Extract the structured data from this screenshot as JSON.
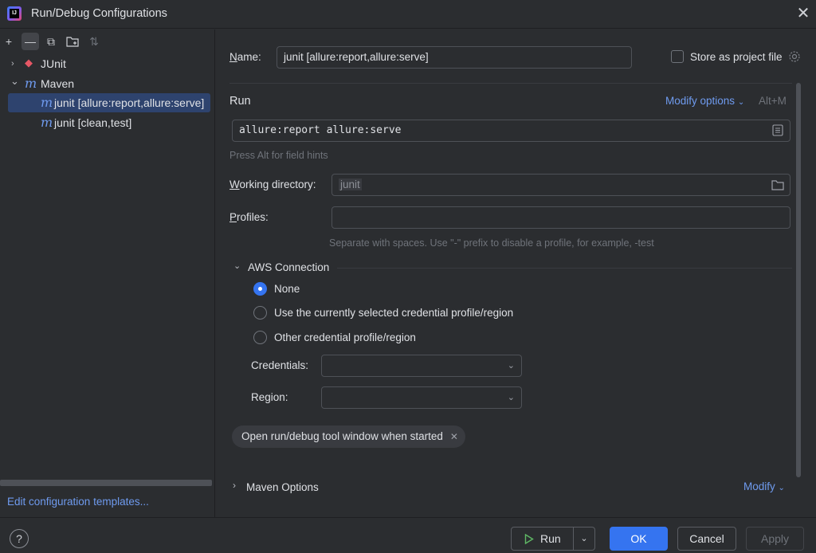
{
  "window": {
    "title": "Run/Debug Configurations",
    "close_glyph": "✕"
  },
  "toolbar": {
    "add": "+",
    "remove": "—",
    "copy": "⧉",
    "folder": "▭",
    "sort": "⇅"
  },
  "tree": {
    "junit": {
      "chev": "›",
      "icon": "◆",
      "label": "JUnit"
    },
    "maven": {
      "chev": "⌄",
      "icon": "m",
      "label": "Maven"
    },
    "item_allure": {
      "icon": "m",
      "label": "junit [allure:report,allure:serve]"
    },
    "item_clean": {
      "icon": "m",
      "label": "junit [clean,test]"
    }
  },
  "edit_templates": "Edit configuration templates...",
  "name": {
    "label_u": "N",
    "label_rest": "ame:",
    "value": "junit [allure:report,allure:serve]"
  },
  "store_as_project_file": "Store as project file",
  "run": {
    "heading": "Run",
    "modify_options": "Modify options",
    "shortcut": "Alt+M",
    "command": "allure:report allure:serve",
    "hint": "Press Alt for field hints"
  },
  "working_dir": {
    "label_u": "W",
    "label_rest": "orking directory:",
    "value": "junit"
  },
  "profiles": {
    "label_u": "P",
    "label_rest": "rofiles:",
    "value": "",
    "hint": "Separate with spaces. Use \"-\" prefix to disable a profile, for example, -test"
  },
  "aws": {
    "heading": "AWS Connection",
    "options": [
      "None",
      "Use the currently selected credential profile/region",
      "Other credential profile/region"
    ],
    "selected": 0,
    "credentials_label": "Credentials:",
    "region_label": "Region:"
  },
  "chip": {
    "label": "Open run/debug tool window when started",
    "close": "✕"
  },
  "maven_options": {
    "heading": "Maven Options",
    "modify": "Modify"
  },
  "buttons": {
    "help": "?",
    "run": "Run",
    "ok": "OK",
    "cancel": "Cancel",
    "apply": "Apply"
  },
  "colors": {
    "accent": "#3574f0",
    "link": "#6f9bef",
    "background": "#2b2d30",
    "selection": "#2e436e"
  }
}
